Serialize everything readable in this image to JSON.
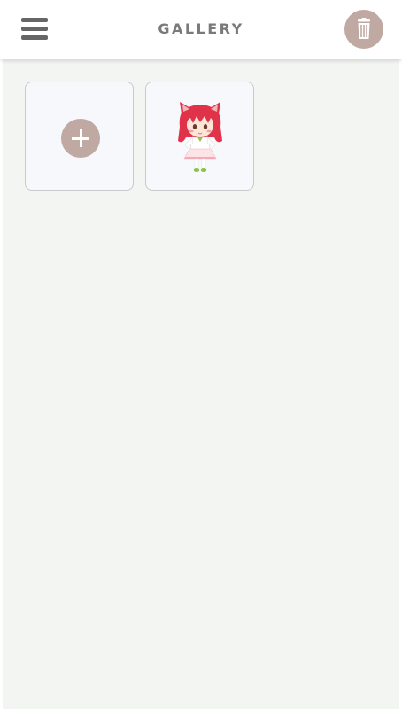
{
  "header": {
    "title": "GALLERY",
    "menu_icon": "hamburger-menu-icon",
    "trash_icon": "trash-icon"
  },
  "gallery": {
    "add_icon": "plus-icon",
    "items": [
      {
        "icon": "chibi-character-thumbnail"
      }
    ]
  },
  "colors": {
    "accent": "#bfa9a2",
    "title": "#7a7a7a",
    "content_bg": "#f3f5f2",
    "tile_bg": "#f6f8fc",
    "character_hair": "#e0334a"
  }
}
